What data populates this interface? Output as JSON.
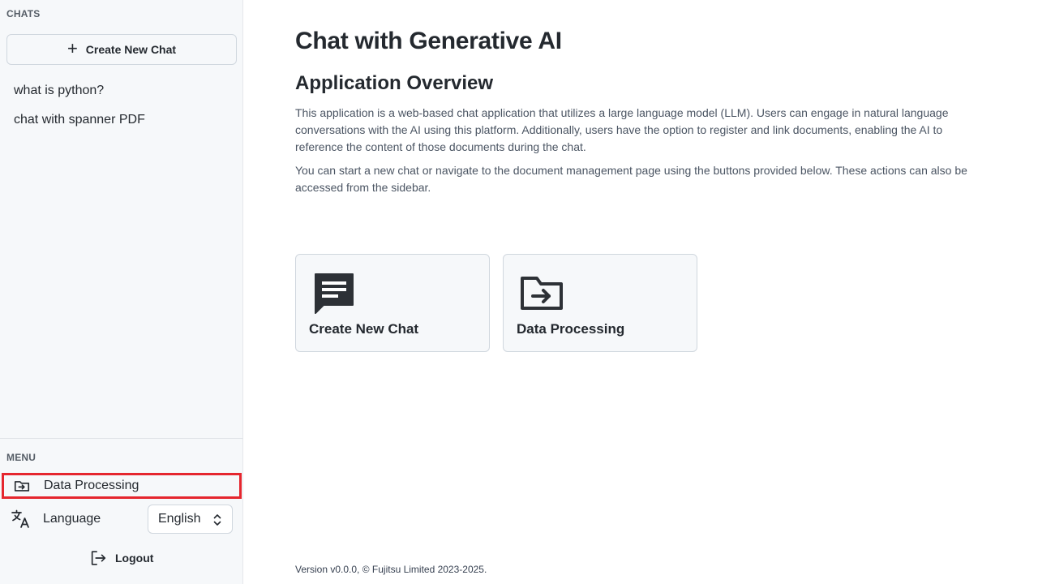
{
  "sidebar": {
    "chats_label": "CHATS",
    "new_chat_button": "Create New Chat",
    "chats": [
      {
        "label": "what is python?"
      },
      {
        "label": "chat with spanner PDF"
      }
    ],
    "menu_label": "MENU",
    "menu": {
      "data_processing": "Data Processing",
      "language_label": "Language",
      "language_value": "English",
      "logout": "Logout"
    }
  },
  "main": {
    "title": "Chat with Generative AI",
    "overview_title": "Application Overview",
    "overview_p1": "This application is a web-based chat application that utilizes a large language model (LLM). Users can engage in natural language conversations with the AI using this platform. Additionally, users have the option to register and link documents, enabling the AI to reference the content of those documents during the chat.",
    "overview_p2": "You can start a new chat or navigate to the document management page using the buttons provided below. These actions can also be accessed from the sidebar.",
    "cards": [
      {
        "label": "Create New Chat",
        "icon": "chat-icon"
      },
      {
        "label": "Data Processing",
        "icon": "folder-arrow-icon"
      }
    ],
    "version": "Version v0.0.0, © Fujitsu Limited 2023-2025."
  },
  "colors": {
    "highlight_border": "#e5262e",
    "sidebar_bg": "#f6f8fa",
    "card_bg": "#f6f8fa"
  }
}
